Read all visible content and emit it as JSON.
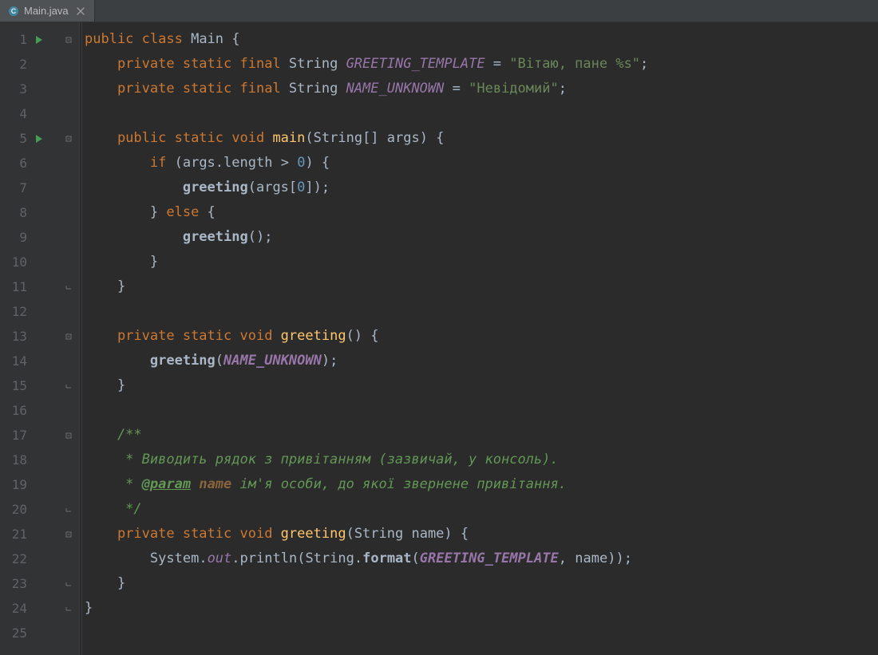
{
  "tab": {
    "label": "Main.java"
  },
  "gutter": {
    "lines": [
      "1",
      "2",
      "3",
      "4",
      "5",
      "6",
      "7",
      "8",
      "9",
      "10",
      "11",
      "12",
      "13",
      "14",
      "15",
      "16",
      "17",
      "18",
      "19",
      "20",
      "21",
      "22",
      "23",
      "24",
      "25"
    ],
    "run_markers": [
      1,
      5
    ],
    "fold_open": [
      1,
      5,
      13,
      17,
      21
    ],
    "fold_close": [
      11,
      15,
      20,
      23,
      24
    ]
  },
  "colors": {
    "bg": "#2b2b2b",
    "gutter": "#313335",
    "keyword": "#cc7832",
    "string": "#6a8759",
    "field": "#9876aa",
    "method": "#ffc66d",
    "number": "#6897bb",
    "comment": "#629755"
  },
  "code": [
    [
      [
        "kw",
        "public "
      ],
      [
        "kw",
        "class "
      ],
      [
        "type",
        "Main "
      ],
      [
        "punc",
        "{"
      ]
    ],
    [
      [
        "kw",
        "    private "
      ],
      [
        "kw",
        "static "
      ],
      [
        "kw",
        "final "
      ],
      [
        "type",
        "String "
      ],
      [
        "field",
        "GREETING_TEMPLATE"
      ],
      [
        "punc",
        " = "
      ],
      [
        "str",
        "\"Вітаю, пане %s\""
      ],
      [
        "punc",
        ";"
      ]
    ],
    [
      [
        "kw",
        "    private "
      ],
      [
        "kw",
        "static "
      ],
      [
        "kw",
        "final "
      ],
      [
        "type",
        "String "
      ],
      [
        "field",
        "NAME_UNKNOWN"
      ],
      [
        "punc",
        " = "
      ],
      [
        "str",
        "\"Невідомий\""
      ],
      [
        "punc",
        ";"
      ]
    ],
    [
      [
        "",
        ""
      ]
    ],
    [
      [
        "kw",
        "    public "
      ],
      [
        "kw",
        "static "
      ],
      [
        "kw",
        "void "
      ],
      [
        "mname",
        "main"
      ],
      [
        "punc",
        "("
      ],
      [
        "type",
        "String"
      ],
      [
        "punc",
        "[] "
      ],
      [
        "ident",
        "args"
      ],
      [
        "punc",
        ") {"
      ]
    ],
    [
      [
        "kw",
        "        if "
      ],
      [
        "punc",
        "("
      ],
      [
        "ident",
        "args"
      ],
      [
        "punc",
        "."
      ],
      [
        "ident",
        "length"
      ],
      [
        "punc",
        " > "
      ],
      [
        "num",
        "0"
      ],
      [
        "punc",
        ") {"
      ]
    ],
    [
      [
        "punc",
        "            "
      ],
      [
        "call",
        "greeting"
      ],
      [
        "punc",
        "("
      ],
      [
        "ident",
        "args"
      ],
      [
        "punc",
        "["
      ],
      [
        "num",
        "0"
      ],
      [
        "punc",
        "]);"
      ]
    ],
    [
      [
        "punc",
        "        } "
      ],
      [
        "kw",
        "else "
      ],
      [
        "punc",
        "{"
      ]
    ],
    [
      [
        "punc",
        "            "
      ],
      [
        "call",
        "greeting"
      ],
      [
        "punc",
        "();"
      ]
    ],
    [
      [
        "punc",
        "        }"
      ]
    ],
    [
      [
        "punc",
        "    }"
      ]
    ],
    [
      [
        "",
        ""
      ]
    ],
    [
      [
        "kw",
        "    private "
      ],
      [
        "kw",
        "static "
      ],
      [
        "kw",
        "void "
      ],
      [
        "mname",
        "greeting"
      ],
      [
        "punc",
        "() {"
      ]
    ],
    [
      [
        "punc",
        "        "
      ],
      [
        "call",
        "greeting"
      ],
      [
        "punc",
        "("
      ],
      [
        "fieldb",
        "NAME_UNKNOWN"
      ],
      [
        "punc",
        ");"
      ]
    ],
    [
      [
        "punc",
        "    }"
      ]
    ],
    [
      [
        "",
        ""
      ]
    ],
    [
      [
        "comment",
        "    /**"
      ]
    ],
    [
      [
        "comment",
        "     * Виводить рядок з привітанням (зазвичай, у консоль)."
      ]
    ],
    [
      [
        "comment",
        "     * "
      ],
      [
        "doctag",
        "@param"
      ],
      [
        "comment",
        " "
      ],
      [
        "docparam",
        "name"
      ],
      [
        "comment",
        " ім'я особи, до якої звернене привітання."
      ]
    ],
    [
      [
        "comment",
        "     */"
      ]
    ],
    [
      [
        "kw",
        "    private "
      ],
      [
        "kw",
        "static "
      ],
      [
        "kw",
        "void "
      ],
      [
        "mname",
        "greeting"
      ],
      [
        "punc",
        "("
      ],
      [
        "type",
        "String "
      ],
      [
        "ident",
        "name"
      ],
      [
        "punc",
        ") {"
      ]
    ],
    [
      [
        "punc",
        "        "
      ],
      [
        "type",
        "System"
      ],
      [
        "punc",
        "."
      ],
      [
        "field",
        "out"
      ],
      [
        "punc",
        "."
      ],
      [
        "ident",
        "println"
      ],
      [
        "punc",
        "("
      ],
      [
        "type",
        "String"
      ],
      [
        "punc",
        "."
      ],
      [
        "call",
        "format"
      ],
      [
        "punc",
        "("
      ],
      [
        "fieldb",
        "GREETING_TEMPLATE"
      ],
      [
        "punc",
        ", "
      ],
      [
        "ident",
        "name"
      ],
      [
        "punc",
        "));"
      ]
    ],
    [
      [
        "punc",
        "    }"
      ]
    ],
    [
      [
        "punc",
        "}"
      ]
    ],
    [
      [
        "",
        ""
      ]
    ]
  ]
}
